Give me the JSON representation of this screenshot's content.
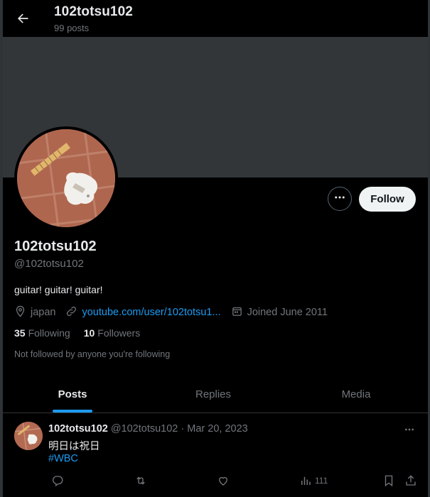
{
  "header": {
    "title": "102totsu102",
    "post_count": "99 posts"
  },
  "profile": {
    "display_name": "102totsu102",
    "handle": "@102totsu102",
    "bio": "guitar! guitar! guitar!",
    "location": "japan",
    "website": "youtube.com/user/102totsu1...",
    "joined": "Joined June 2011",
    "following_count": "35",
    "following_label": "Following",
    "followers_count": "10",
    "followers_label": "Followers",
    "not_followed_text": "Not followed by anyone you're following",
    "follow_label": "Follow"
  },
  "tabs": [
    {
      "label": "Posts",
      "active": true
    },
    {
      "label": "Replies",
      "active": false
    },
    {
      "label": "Media",
      "active": false
    }
  ],
  "post": {
    "name": "102totsu102",
    "handle_date": "@102totsu102 · Mar 20, 2023",
    "text": "明日は祝日",
    "hashtag": "#WBC",
    "views": "111"
  },
  "colors": {
    "accent": "#1d9bf0",
    "banner": "#333639",
    "muted": "#71767b"
  },
  "icons": [
    "back-arrow-icon",
    "more-icon",
    "location-icon",
    "link-icon",
    "calendar-icon",
    "reply-icon",
    "retweet-icon",
    "like-icon",
    "views-icon",
    "bookmark-icon",
    "share-icon"
  ]
}
